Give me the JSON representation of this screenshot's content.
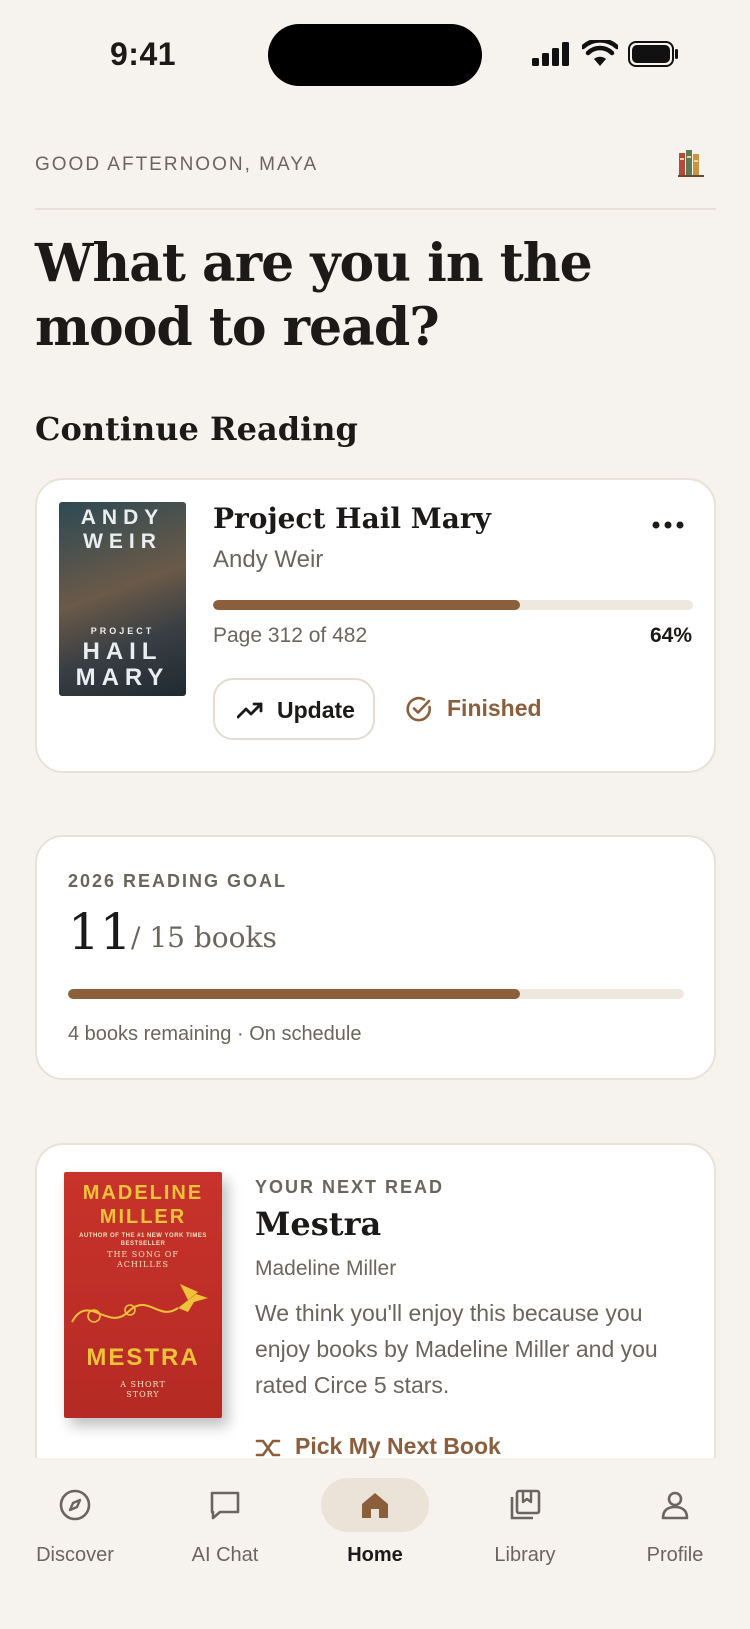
{
  "status_bar": {
    "time": "9:41"
  },
  "header": {
    "greeting": "GOOD AFTERNOON, MAYA",
    "headline": "What are you in the mood to read?"
  },
  "continue_reading": {
    "section_title": "Continue Reading",
    "book": {
      "title": "Project Hail Mary",
      "author": "Andy Weir",
      "cover_author": "ANDY WEIR",
      "cover_small": "PROJECT",
      "cover_title_1": "HAIL",
      "cover_title_2": "MARY",
      "pages_text": "Page 312 of 482",
      "percent_text": "64%",
      "progress": 0.64
    },
    "update_label": "Update",
    "finished_label": "Finished"
  },
  "reading_goal": {
    "label": "2026 READING GOAL",
    "count": "11",
    "of_text": "/ 15 books",
    "progress": 0.7333,
    "subtitle": "4 books remaining · On schedule"
  },
  "next_read": {
    "kicker": "YOUR NEXT READ",
    "title": "Mestra",
    "author": "Madeline Miller",
    "cover_author_1": "MADELINE",
    "cover_author_2": "MILLER",
    "cover_tag": "AUTHOR OF THE #1 NEW YORK TIMES BESTSELLER",
    "cover_prev": "THE SONG OF ACHILLES",
    "cover_title": "MESTRA",
    "cover_sub": "A SHORT STORY",
    "reason": "We think you'll enjoy this because you enjoy books by Madeline Miller and you rated Circe 5 stars.",
    "pick_label": "Pick My Next Book"
  },
  "tabs": [
    {
      "label": "Discover",
      "icon": "compass-icon"
    },
    {
      "label": "AI Chat",
      "icon": "chat-bubble-icon"
    },
    {
      "label": "Home",
      "icon": "home-icon"
    },
    {
      "label": "Library",
      "icon": "library-icon"
    },
    {
      "label": "Profile",
      "icon": "person-icon"
    }
  ],
  "colors": {
    "accent": "#8b5e3c",
    "background": "#f6f3ee",
    "track": "#efe8df"
  }
}
